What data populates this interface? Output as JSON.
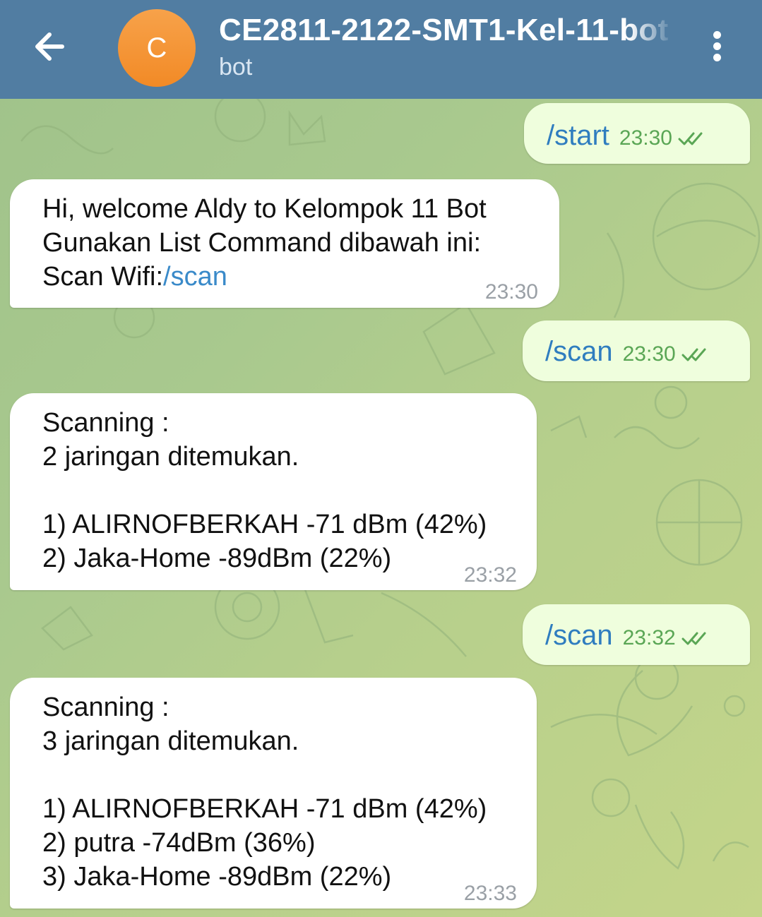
{
  "header": {
    "avatar_letter": "C",
    "title": "CE2811-2122-SMT1-Kel-11-bot",
    "subtitle": "bot"
  },
  "messages": [
    {
      "direction": "out",
      "text": "/start",
      "time": "23:30",
      "status": "read"
    },
    {
      "direction": "in",
      "lines": [
        "Hi, welcome Aldy to Kelompok 11 Bot",
        "Gunakan List  Command dibawah ini:"
      ],
      "prefix": "Scan Wifi:",
      "command": "/scan",
      "time": "23:30"
    },
    {
      "direction": "out",
      "text": "/scan",
      "time": "23:30",
      "status": "read"
    },
    {
      "direction": "in",
      "text": "Scanning :\n2 jaringan ditemukan.\n\n1) ALIRNOFBERKAH -71 dBm (42%)\n2) Jaka-Home -89dBm (22%)",
      "time": "23:32"
    },
    {
      "direction": "out",
      "text": "/scan",
      "time": "23:32",
      "status": "read"
    },
    {
      "direction": "in",
      "text": "Scanning :\n3 jaringan ditemukan.\n\n1) ALIRNOFBERKAH -71 dBm (42%)\n2) putra -74dBm (36%)\n3) Jaka-Home -89dBm (22%)",
      "time": "23:33"
    }
  ],
  "colors": {
    "header": "#517da2",
    "avatar": "#f28a26",
    "incoming_bubble": "#ffffff",
    "outgoing_bubble": "#effedd",
    "command_link": "#3a8ac9",
    "read_check": "#5aa655"
  }
}
